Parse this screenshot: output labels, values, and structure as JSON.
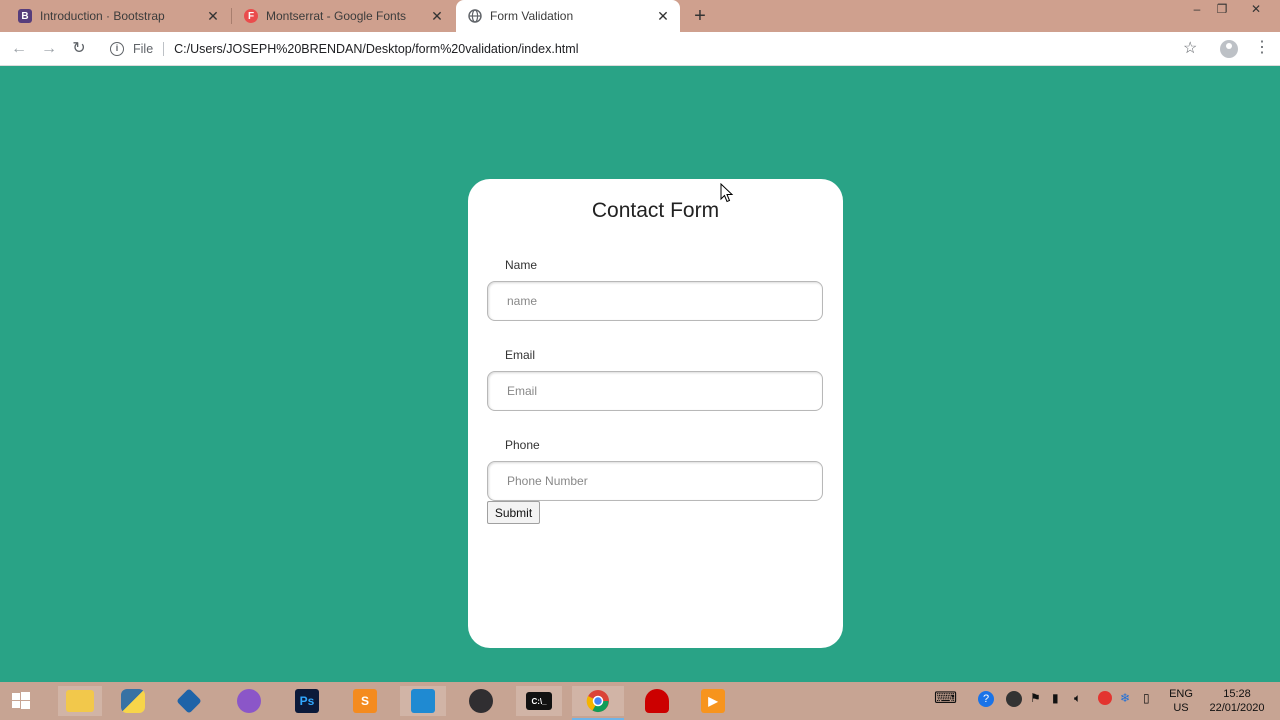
{
  "browser": {
    "tabs": [
      {
        "title": "Introduction · Bootstrap",
        "favicon": "B",
        "favicon_color": "#563d7c",
        "active": false
      },
      {
        "title": "Montserrat - Google Fonts",
        "favicon": "F",
        "favicon_color": "#ea4c4c",
        "active": false
      },
      {
        "title": "Form Validation",
        "favicon": "globe-icon",
        "active": true
      }
    ],
    "address": {
      "scheme_label": "File",
      "url": "C:/Users/JOSEPH%20BRENDAN/Desktop/form%20validation/index.html"
    }
  },
  "page": {
    "background_color": "#29a386",
    "form": {
      "title": "Contact Form",
      "fields": [
        {
          "label": "Name",
          "placeholder": "name",
          "value": ""
        },
        {
          "label": "Email",
          "placeholder": "Email",
          "value": ""
        },
        {
          "label": "Phone",
          "placeholder": "Phone Number",
          "value": ""
        }
      ],
      "submit_label": "Submit"
    }
  },
  "taskbar": {
    "apps": [
      "windows-start",
      "file-explorer",
      "python",
      "virtualbox",
      "github-desktop",
      "photoshop",
      "sublime-text",
      "vscode",
      "obs",
      "terminal",
      "chrome",
      "redhat",
      "media-player"
    ],
    "active_app": "chrome",
    "language": {
      "line1": "ENG",
      "line2": "US"
    },
    "clock": {
      "time": "15:28",
      "date": "22/01/2020"
    }
  }
}
